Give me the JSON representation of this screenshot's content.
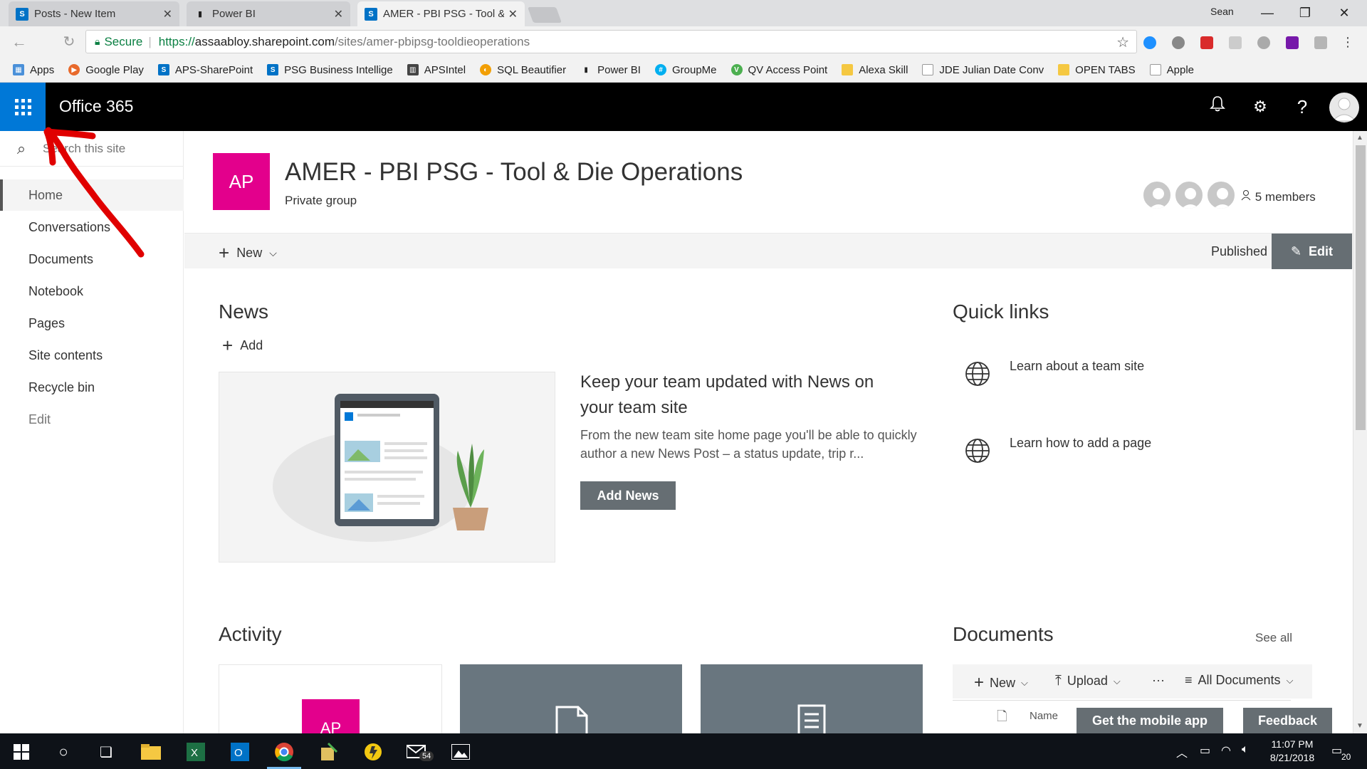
{
  "browser": {
    "tabs": [
      {
        "title": "Posts - New Item",
        "favicon": "sharepoint-icon"
      },
      {
        "title": "Power BI",
        "favicon": "powerbi-icon"
      },
      {
        "title": "AMER - PBI PSG - Tool &",
        "favicon": "sharepoint-icon"
      }
    ],
    "user": "Sean",
    "secure_label": "Secure",
    "url_scheme": "https://",
    "url_host": "assaabloy.sharepoint.com",
    "url_path": "/sites/amer-pbipsg-tooldieoperations",
    "bookmarks": [
      {
        "label": "Apps",
        "icon": "apps-grid-icon"
      },
      {
        "label": "Google Play",
        "icon": "google-play-icon"
      },
      {
        "label": "APS-SharePoint",
        "icon": "sharepoint-icon"
      },
      {
        "label": "PSG Business Intellige",
        "icon": "sharepoint-icon"
      },
      {
        "label": "APSIntel",
        "icon": "bar-chart-icon"
      },
      {
        "label": "SQL Beautifier",
        "icon": "sql-icon"
      },
      {
        "label": "Power BI",
        "icon": "powerbi-icon"
      },
      {
        "label": "GroupMe",
        "icon": "groupme-icon"
      },
      {
        "label": "QV Access Point",
        "icon": "qlikview-icon"
      },
      {
        "label": "Alexa Skill",
        "icon": "folder-icon"
      },
      {
        "label": "JDE Julian Date Conv",
        "icon": "page-icon"
      },
      {
        "label": "OPEN TABS",
        "icon": "folder-icon"
      },
      {
        "label": "Apple",
        "icon": "page-icon"
      }
    ]
  },
  "suite": {
    "app_name": "Office 365"
  },
  "nav": {
    "search_placeholder": "Search this site",
    "items": [
      {
        "label": "Home"
      },
      {
        "label": "Conversations"
      },
      {
        "label": "Documents"
      },
      {
        "label": "Notebook"
      },
      {
        "label": "Pages"
      },
      {
        "label": "Site contents"
      },
      {
        "label": "Recycle bin"
      },
      {
        "label": "Edit"
      }
    ]
  },
  "site": {
    "logo_initials": "AP",
    "title": "AMER - PBI PSG - Tool & Die Operations",
    "subtitle": "Private group",
    "members_label": "5 members"
  },
  "commandbar": {
    "new_label": "New",
    "status": "Published",
    "edit_label": "Edit"
  },
  "news": {
    "title": "News",
    "add_label": "Add",
    "headline": "Keep your team updated with News on your team site",
    "body": "From the new team site home page you'll be able to quickly author a new News Post – a status update, trip r...",
    "button": "Add News"
  },
  "quick_links": {
    "title": "Quick links",
    "items": [
      {
        "label": "Learn about a team site"
      },
      {
        "label": "Learn how to add a page"
      }
    ]
  },
  "activity": {
    "title": "Activity",
    "card_initials": "AP"
  },
  "documents": {
    "title": "Documents",
    "see_all": "See all",
    "new_label": "New",
    "upload_label": "Upload",
    "more_label": "···",
    "view_label": "All Documents",
    "col_name": "Name"
  },
  "footer_buttons": {
    "mobile": "Get the mobile app",
    "feedback": "Feedback"
  },
  "taskbar": {
    "time": "11:07 PM",
    "date": "8/21/2018",
    "mail_badge": "54",
    "notif_count": "20"
  },
  "colors": {
    "suite_bar": "#000000",
    "waffle": "#0078d7",
    "site_logo": "#e3008c",
    "button": "#666e73",
    "annotation": "#e00000"
  }
}
